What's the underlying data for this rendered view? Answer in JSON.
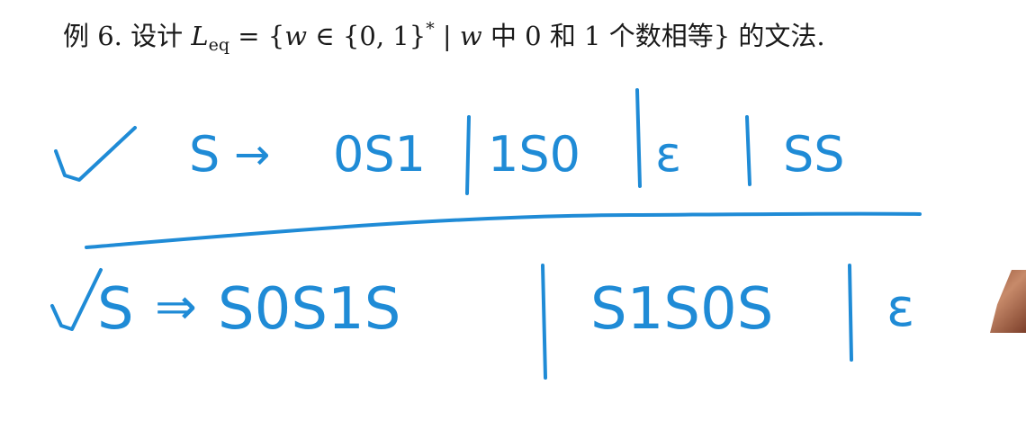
{
  "problem": {
    "prefix": "例 6. 设计 ",
    "lang_var": "L",
    "lang_sub": "eq",
    "eq_open": " = {",
    "var_w": "w",
    "in_set": " ∈ {0, 1}",
    "star": "*",
    "sep": " | ",
    "var_w2": "w",
    "condition": " 中 0 和 1 个数相等} 的文法."
  },
  "handwriting": {
    "line1": {
      "check": "✓",
      "lhs": "S",
      "arrow": "→",
      "alt1": "0S1",
      "alt2": "1S0",
      "alt3": "ε",
      "alt4": "SS"
    },
    "line2": {
      "check": "✓",
      "lhs": "S",
      "arrow": "⇒",
      "alt1": "S0S1S",
      "alt2": "S1S0S",
      "alt3": "ε"
    }
  },
  "colors": {
    "ink": "#1f8bd6",
    "text": "#1a1a1a",
    "background": "#ffffff"
  }
}
